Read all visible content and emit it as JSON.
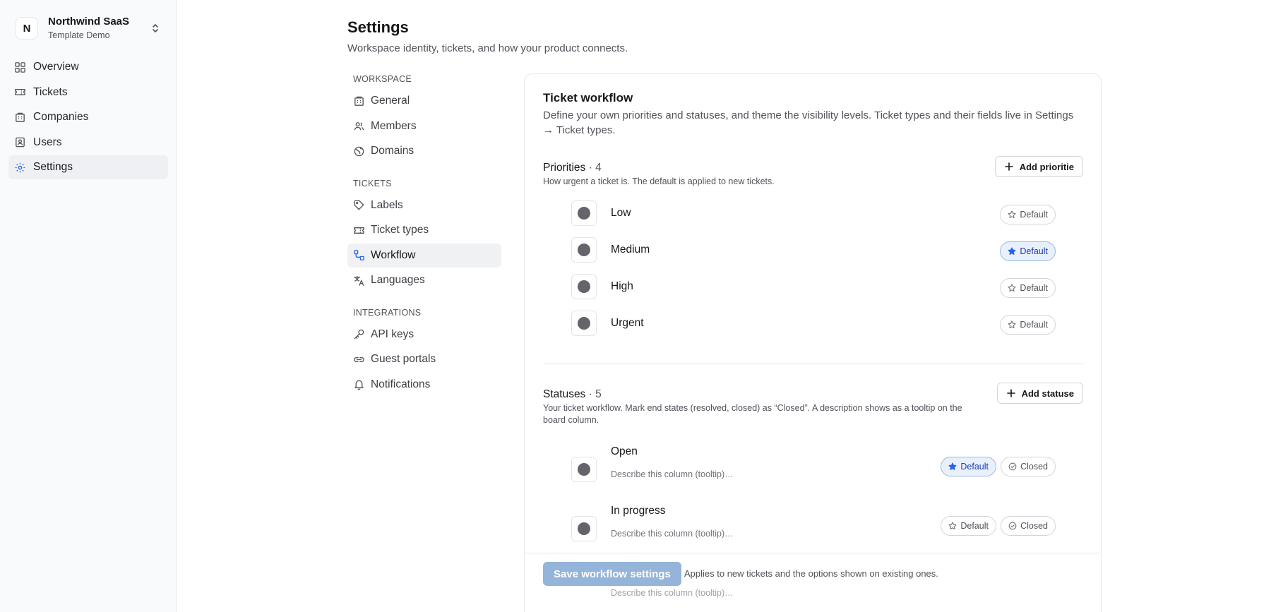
{
  "workspace": {
    "avatar": "N",
    "name": "Northwind SaaS",
    "subtitle": "Template Demo"
  },
  "app_nav": [
    {
      "label": "Overview",
      "icon": "grid-icon"
    },
    {
      "label": "Tickets",
      "icon": "ticket-icon"
    },
    {
      "label": "Companies",
      "icon": "building-icon"
    },
    {
      "label": "Users",
      "icon": "user-badge-icon"
    },
    {
      "label": "Settings",
      "icon": "gear-icon",
      "active": true
    }
  ],
  "header": {
    "title": "Settings",
    "subtitle": "Workspace identity, tickets, and how your product connects."
  },
  "settings_nav": {
    "workspace": {
      "heading": "Workspace",
      "items": [
        "General",
        "Members",
        "Domains"
      ]
    },
    "tickets": {
      "heading": "Tickets",
      "items": [
        "Labels",
        "Ticket types",
        "Workflow",
        "Languages"
      ]
    },
    "integrations": {
      "heading": "Integrations",
      "items": [
        "API keys",
        "Guest portals",
        "Notifications"
      ]
    },
    "active": "Workflow"
  },
  "card": {
    "title": "Ticket workflow",
    "description": "Define your own priorities and statuses, and theme the visibility levels. Ticket types and their fields live in Settings → Ticket types."
  },
  "priorities": {
    "title": "Priorities",
    "count": "· 4",
    "description": "How urgent a ticket is. The default is applied to new tickets.",
    "add_label": "Add prioritie",
    "default_label": "Default",
    "items": [
      {
        "label": "Low",
        "is_default": false
      },
      {
        "label": "Medium",
        "is_default": true
      },
      {
        "label": "High",
        "is_default": false
      },
      {
        "label": "Urgent",
        "is_default": false
      }
    ]
  },
  "statuses": {
    "title": "Statuses",
    "count": "· 5",
    "description": "Your ticket workflow. Mark end states (resolved, closed) as “Closed”. A description shows as a tooltip on the board column.",
    "add_label": "Add statuse",
    "default_label": "Default",
    "closed_label": "Closed",
    "desc_placeholder": "Describe this column (tooltip)…",
    "items": [
      {
        "label": "Open",
        "is_default": true
      },
      {
        "label": "In progress",
        "is_default": false
      }
    ]
  },
  "footer": {
    "save_label": "Save workflow settings",
    "note": "Applies to new tickets and the options shown on existing ones.",
    "ghost_desc": "Describe this column (tooltip)…"
  },
  "colors": {
    "accent": "#1e40af",
    "save_button": "#94b4da",
    "swatch_dot": "#64656b",
    "active_pill_bg": "#e8f0fb"
  }
}
